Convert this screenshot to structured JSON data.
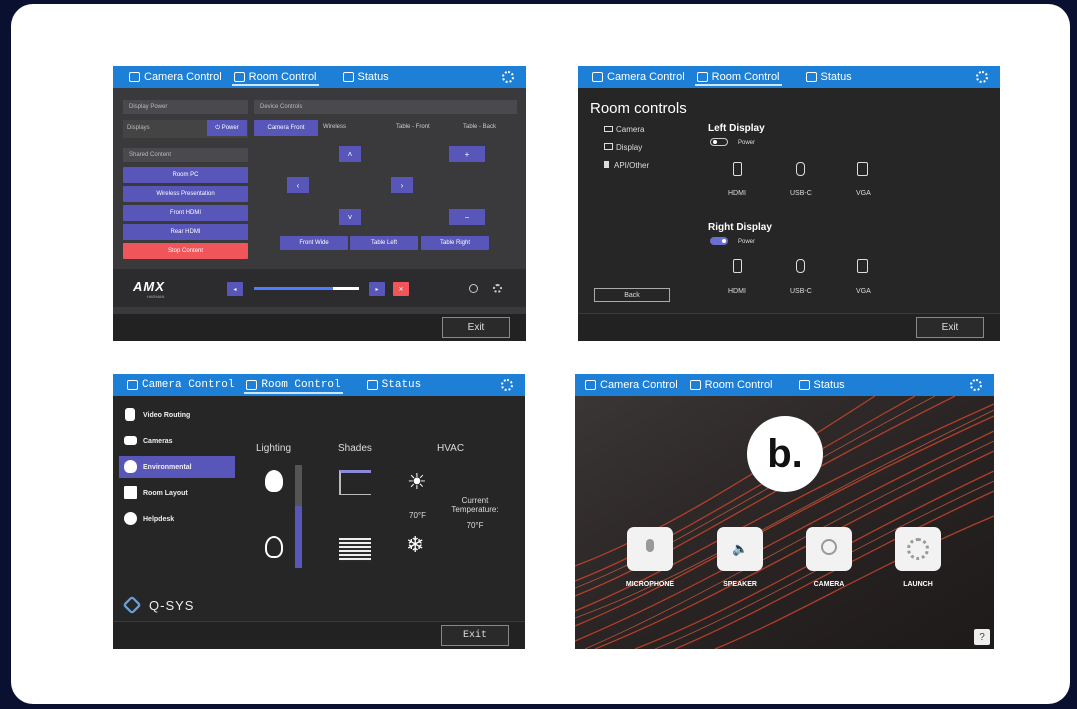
{
  "tabs": {
    "camera_control": "Camera Control",
    "room_control": "Room Control",
    "status": "Status"
  },
  "exit_label": "Exit",
  "panel_amx": {
    "display_power_title": "Display Power",
    "displays_label": "Displays",
    "power_button": "Power",
    "shared_content_title": "Shared Content",
    "sources": [
      "Room PC",
      "Wireless Presentation",
      "Front HDMI",
      "Rear HDMI"
    ],
    "stop_content": "Stop Content",
    "device_controls_title": "Device Controls",
    "device_tabs": [
      "Camera Front",
      "Wireless",
      "Table - Front",
      "Table - Back"
    ],
    "presets": [
      "Front Wide",
      "Table Left",
      "Table Right"
    ],
    "logo": "AMX",
    "logo_sub": "HARMAN",
    "volume_level": 0.75
  },
  "panel_room": {
    "heading": "Room controls",
    "nav": [
      "Camera",
      "Display",
      "API/Other"
    ],
    "left_display": "Left Display",
    "right_display": "Right Display",
    "power_label": "Power",
    "ports": [
      "HDMI",
      "USB-C",
      "VGA"
    ],
    "back_button": "Back"
  },
  "panel_qsys": {
    "nav": [
      "Video Routing",
      "Cameras",
      "Environmental",
      "Room Layout",
      "Helpdesk"
    ],
    "columns": [
      "Lighting",
      "Shades",
      "HVAC"
    ],
    "setpoint": "70°F",
    "current_temp_label": "Current Temperature:",
    "current_temp_value": "70°F",
    "logo": "Q-SYS",
    "lighting_level": 0.6
  },
  "panel_b": {
    "logo_letter": "b.",
    "tiles": [
      "MICROPHONE",
      "SPEAKER",
      "CAMERA",
      "LAUNCH"
    ],
    "help": "?"
  },
  "colors": {
    "tabbar": "#1e7fd6",
    "accent_purple": "#5856b8",
    "stop_red": "#f0555a",
    "logo_red": "#e0403a"
  }
}
